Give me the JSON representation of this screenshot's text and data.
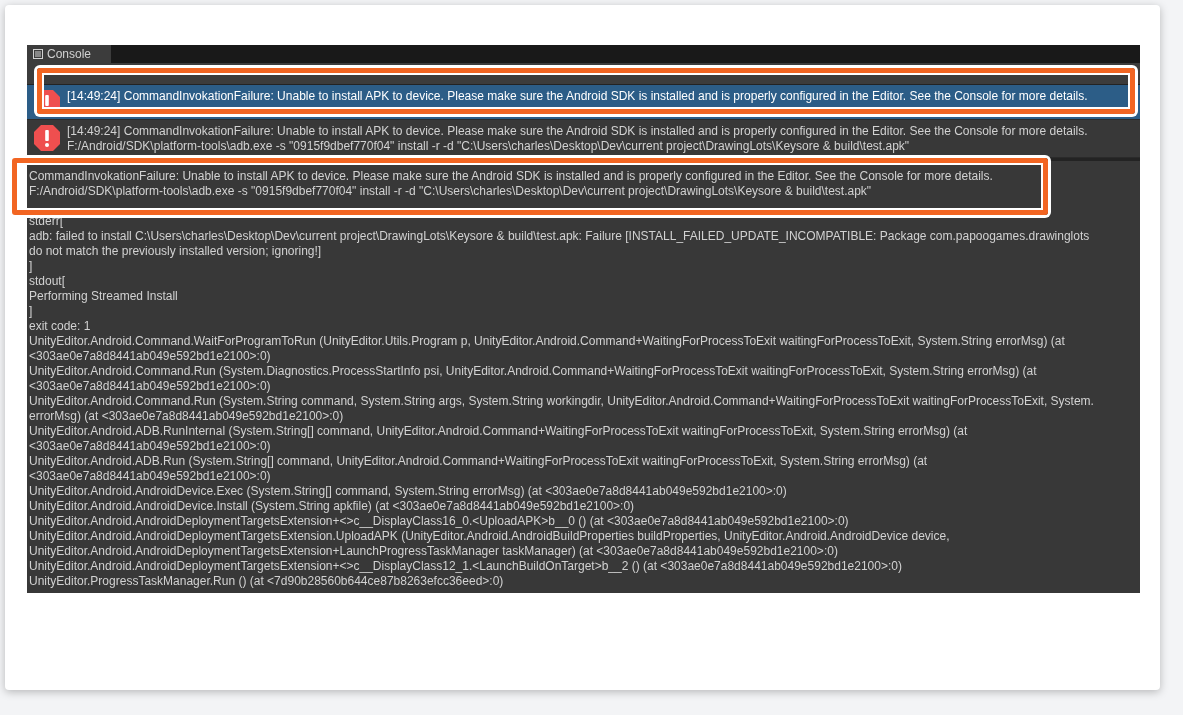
{
  "window": {
    "tab": "Console"
  },
  "entries": [
    {
      "kind": "error",
      "selected": true,
      "lines": [
        "[14:49:24] CommandInvokationFailure: Unable to install APK to device. Please make sure the Android SDK is installed and is properly configured in the Editor. See the Console for more details."
      ]
    },
    {
      "kind": "error",
      "selected": false,
      "lines": [
        "[14:49:24] CommandInvokationFailure: Unable to install APK to device. Please make sure the Android SDK is installed and is properly configured in the Editor. See the Console for more details.",
        "F:/Android/SDK\\platform-tools\\adb.exe -s \"0915f9dbef770f04\" install -r -d \"C:\\Users\\charles\\Desktop\\Dev\\current project\\DrawingLots\\Keysore & build\\test.apk\""
      ]
    }
  ],
  "detail": {
    "lines": [
      "CommandInvokationFailure: Unable to install APK to device. Please make sure the Android SDK is installed and is properly configured in the Editor. See the Console for more details.",
      "F:/Android/SDK\\platform-tools\\adb.exe -s \"0915f9dbef770f04\" install -r -d \"C:\\Users\\charles\\Desktop\\Dev\\current project\\DrawingLots\\Keysore & build\\test.apk\"",
      "stderr[",
      "adb: failed to install C:\\Users\\charles\\Desktop\\Dev\\current project\\DrawingLots\\Keysore & build\\test.apk: Failure [INSTALL_FAILED_UPDATE_INCOMPATIBLE: Package com.papoogames.drawinglots",
      "do not match the previously installed version; ignoring!]",
      "]",
      "stdout[",
      "Performing Streamed Install",
      "]",
      "exit code: 1",
      "UnityEditor.Android.Command.WaitForProgramToRun (UnityEditor.Utils.Program p, UnityEditor.Android.Command+WaitingForProcessToExit waitingForProcessToExit, System.String errorMsg) (at",
      "<303ae0e7a8d8441ab049e592bd1e2100>:0)",
      "UnityEditor.Android.Command.Run (System.Diagnostics.ProcessStartInfo psi, UnityEditor.Android.Command+WaitingForProcessToExit waitingForProcessToExit, System.String errorMsg) (at",
      "<303ae0e7a8d8441ab049e592bd1e2100>:0)",
      "UnityEditor.Android.Command.Run (System.String command, System.String args, System.String workingdir, UnityEditor.Android.Command+WaitingForProcessToExit waitingForProcessToExit, System.",
      "errorMsg) (at <303ae0e7a8d8441ab049e592bd1e2100>:0)",
      "UnityEditor.Android.ADB.RunInternal (System.String[] command, UnityEditor.Android.Command+WaitingForProcessToExit waitingForProcessToExit, System.String errorMsg) (at",
      "<303ae0e7a8d8441ab049e592bd1e2100>:0)",
      "UnityEditor.Android.ADB.Run (System.String[] command, UnityEditor.Android.Command+WaitingForProcessToExit waitingForProcessToExit, System.String errorMsg) (at",
      "<303ae0e7a8d8441ab049e592bd1e2100>:0)",
      "UnityEditor.Android.AndroidDevice.Exec (System.String[] command, System.String errorMsg) (at <303ae0e7a8d8441ab049e592bd1e2100>:0)",
      "UnityEditor.Android.AndroidDevice.Install (System.String apkfile) (at <303ae0e7a8d8441ab049e592bd1e2100>:0)",
      "UnityEditor.Android.AndroidDeploymentTargetsExtension+<>c__DisplayClass16_0.<UploadAPK>b__0 () (at <303ae0e7a8d8441ab049e592bd1e2100>:0)",
      "UnityEditor.Android.AndroidDeploymentTargetsExtension.UploadAPK (UnityEditor.Android.AndroidBuildProperties buildProperties, UnityEditor.Android.AndroidDevice device,",
      "UnityEditor.Android.AndroidDeploymentTargetsExtension+LaunchProgressTaskManager taskManager) (at <303ae0e7a8d8441ab049e592bd1e2100>:0)",
      "UnityEditor.Android.AndroidDeploymentTargetsExtension+<>c__DisplayClass12_1.<LaunchBuildOnTarget>b__2 () (at <303ae0e7a8d8441ab049e592bd1e2100>:0)",
      "UnityEditor.ProgressTaskManager.Run () (at <7d90b28560b644ce87b8263efcc36eed>:0)"
    ]
  }
}
